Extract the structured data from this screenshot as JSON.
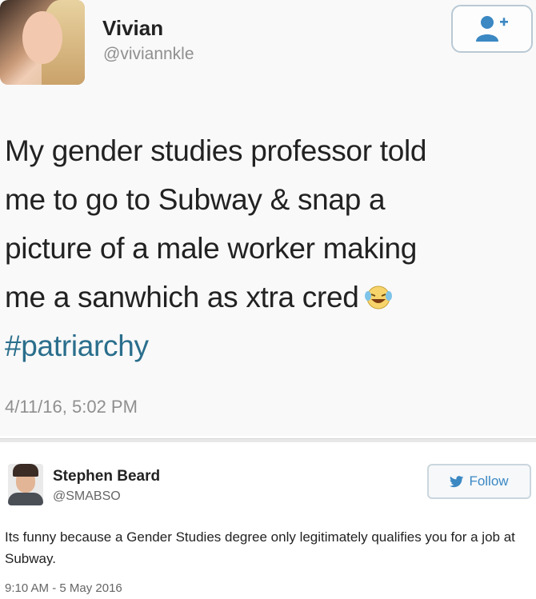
{
  "tweet": {
    "author_name": "Vivian",
    "author_handle": "@viviannkle",
    "text_lines": [
      "My gender studies professor told",
      "me to go to Subway & snap a",
      "picture of a male worker making",
      "me a sanwhich as xtra cred"
    ],
    "hashtag": "#patriarchy",
    "timestamp": "4/11/16, 5:02 PM",
    "emoji_icon": "laughing-crying-emoji-icon",
    "follow_icon": "add-user-icon"
  },
  "reply": {
    "author_name": "Stephen Beard",
    "author_handle": "@SMABSO",
    "follow_label": "Follow",
    "follow_icon": "bird-icon",
    "text": "Its funny because a Gender Studies degree only legitimately qualifies you for a job at Subway.",
    "timestamp": "9:10 AM - 5 May 2016"
  },
  "colors": {
    "hashtag": "#2a6e8c",
    "twitter_blue": "#3b88c3",
    "muted": "#8f8f8f"
  }
}
